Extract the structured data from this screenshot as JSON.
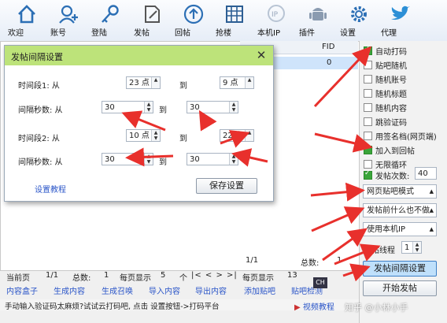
{
  "toolbar": [
    {
      "label": "欢迎",
      "icon": "home-icon"
    },
    {
      "label": "账号",
      "icon": "add-user-icon"
    },
    {
      "label": "登陆",
      "icon": "key-icon"
    },
    {
      "label": "发帖",
      "icon": "edit-document-icon"
    },
    {
      "label": "回帖",
      "icon": "upload-icon"
    },
    {
      "label": "抢楼",
      "icon": "calendar-grid-icon"
    },
    {
      "label": "本机IP",
      "icon": "ip-pin-icon"
    },
    {
      "label": "插件",
      "icon": "android-icon"
    },
    {
      "label": "设置",
      "icon": "gear-icon"
    },
    {
      "label": "代理",
      "icon": "bird-icon"
    }
  ],
  "list": {
    "col_fid": "FID",
    "row_fid": "0",
    "pager_text": "1/1",
    "total_label": "总数:",
    "total": "1"
  },
  "dialog": {
    "title": "发帖间隔设置",
    "period1_label": "时间段1: 从",
    "period1_from": "23 点",
    "to": "到",
    "period1_to": "9 点",
    "interval1_label": "间隔秒数: 从",
    "interval1_from": "30",
    "interval1_to": "30",
    "period2_label": "时间段2: 从",
    "period2_from": "10 点",
    "period2_to": "22 点",
    "interval2_label": "间隔秒数: 从",
    "interval2_from": "30",
    "interval2_to": "30",
    "tutorial_link": "设置教程",
    "save_button": "保存设置"
  },
  "right_panel": {
    "checkboxes": [
      {
        "label": "自动打码",
        "checked": true
      },
      {
        "label": "贴吧随机",
        "checked": false
      },
      {
        "label": "随机账号",
        "checked": false
      },
      {
        "label": "随机标题",
        "checked": false
      },
      {
        "label": "随机内容",
        "checked": false
      },
      {
        "label": "跳验证码",
        "checked": false
      },
      {
        "label": "用签名档(网页端)",
        "checked": false
      },
      {
        "label": "加入到回帖",
        "checked": true
      },
      {
        "label": "无限循环",
        "checked": false
      },
      {
        "label": "发帖次数:",
        "checked": true
      }
    ],
    "post_count": "40",
    "mode_select": "网页贴吧模式",
    "before_select": "发帖前什么也不做",
    "ip_select": "使用本机IP",
    "threads_label": "发帖线程",
    "threads_value": "1",
    "interval_button": "发帖间隔设置",
    "start_button": "开始发帖"
  },
  "pager": {
    "current_page_label": "当前页",
    "current_page": "1/1",
    "total_label": "总数:",
    "total": "1",
    "per_page_label": "每页显示",
    "per_page": "5",
    "unit": "个",
    "nav": "|< < > >|",
    "per_page2": "13"
  },
  "bottom_tabs": [
    "内容盒子",
    "生成内容",
    "生成召唤",
    "导入内容",
    "导出内容",
    "添加贴吧",
    "贴吧检测"
  ],
  "status_text": "手动输入验证码太麻烦?试试云打码吧, 点击 设置按钮->打码平台",
  "video_tutorial": "视频教程",
  "watermark": "知乎 @小林小手",
  "colors": {
    "dialog_title": "#bde37a",
    "arrow": "#e8302c",
    "selected_button": "#bfe0fb",
    "link": "#2a55c8"
  }
}
